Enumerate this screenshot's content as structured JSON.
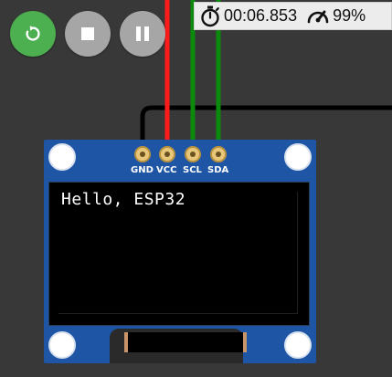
{
  "controls": {
    "restart": {
      "icon": "restart-icon",
      "color": "#4caf50"
    },
    "stop": {
      "icon": "stop-icon",
      "color": "#a6a6a6"
    },
    "pause": {
      "icon": "pause-icon",
      "color": "#a6a6a6"
    }
  },
  "status": {
    "timer": "00:06.853",
    "speed": "99%",
    "timer_icon": "stopwatch-icon",
    "speed_icon": "speedometer-icon"
  },
  "wires": {
    "gnd_color": "#000000",
    "vcc_color": "#ff0000",
    "scl_color": "#008000",
    "sda_color": "#008000"
  },
  "oled": {
    "board_color": "#1e55a5",
    "pins": [
      {
        "label": "GND"
      },
      {
        "label": "VCC"
      },
      {
        "label": "SCL"
      },
      {
        "label": "SDA"
      }
    ],
    "display_text": "Hello, ESP32"
  }
}
